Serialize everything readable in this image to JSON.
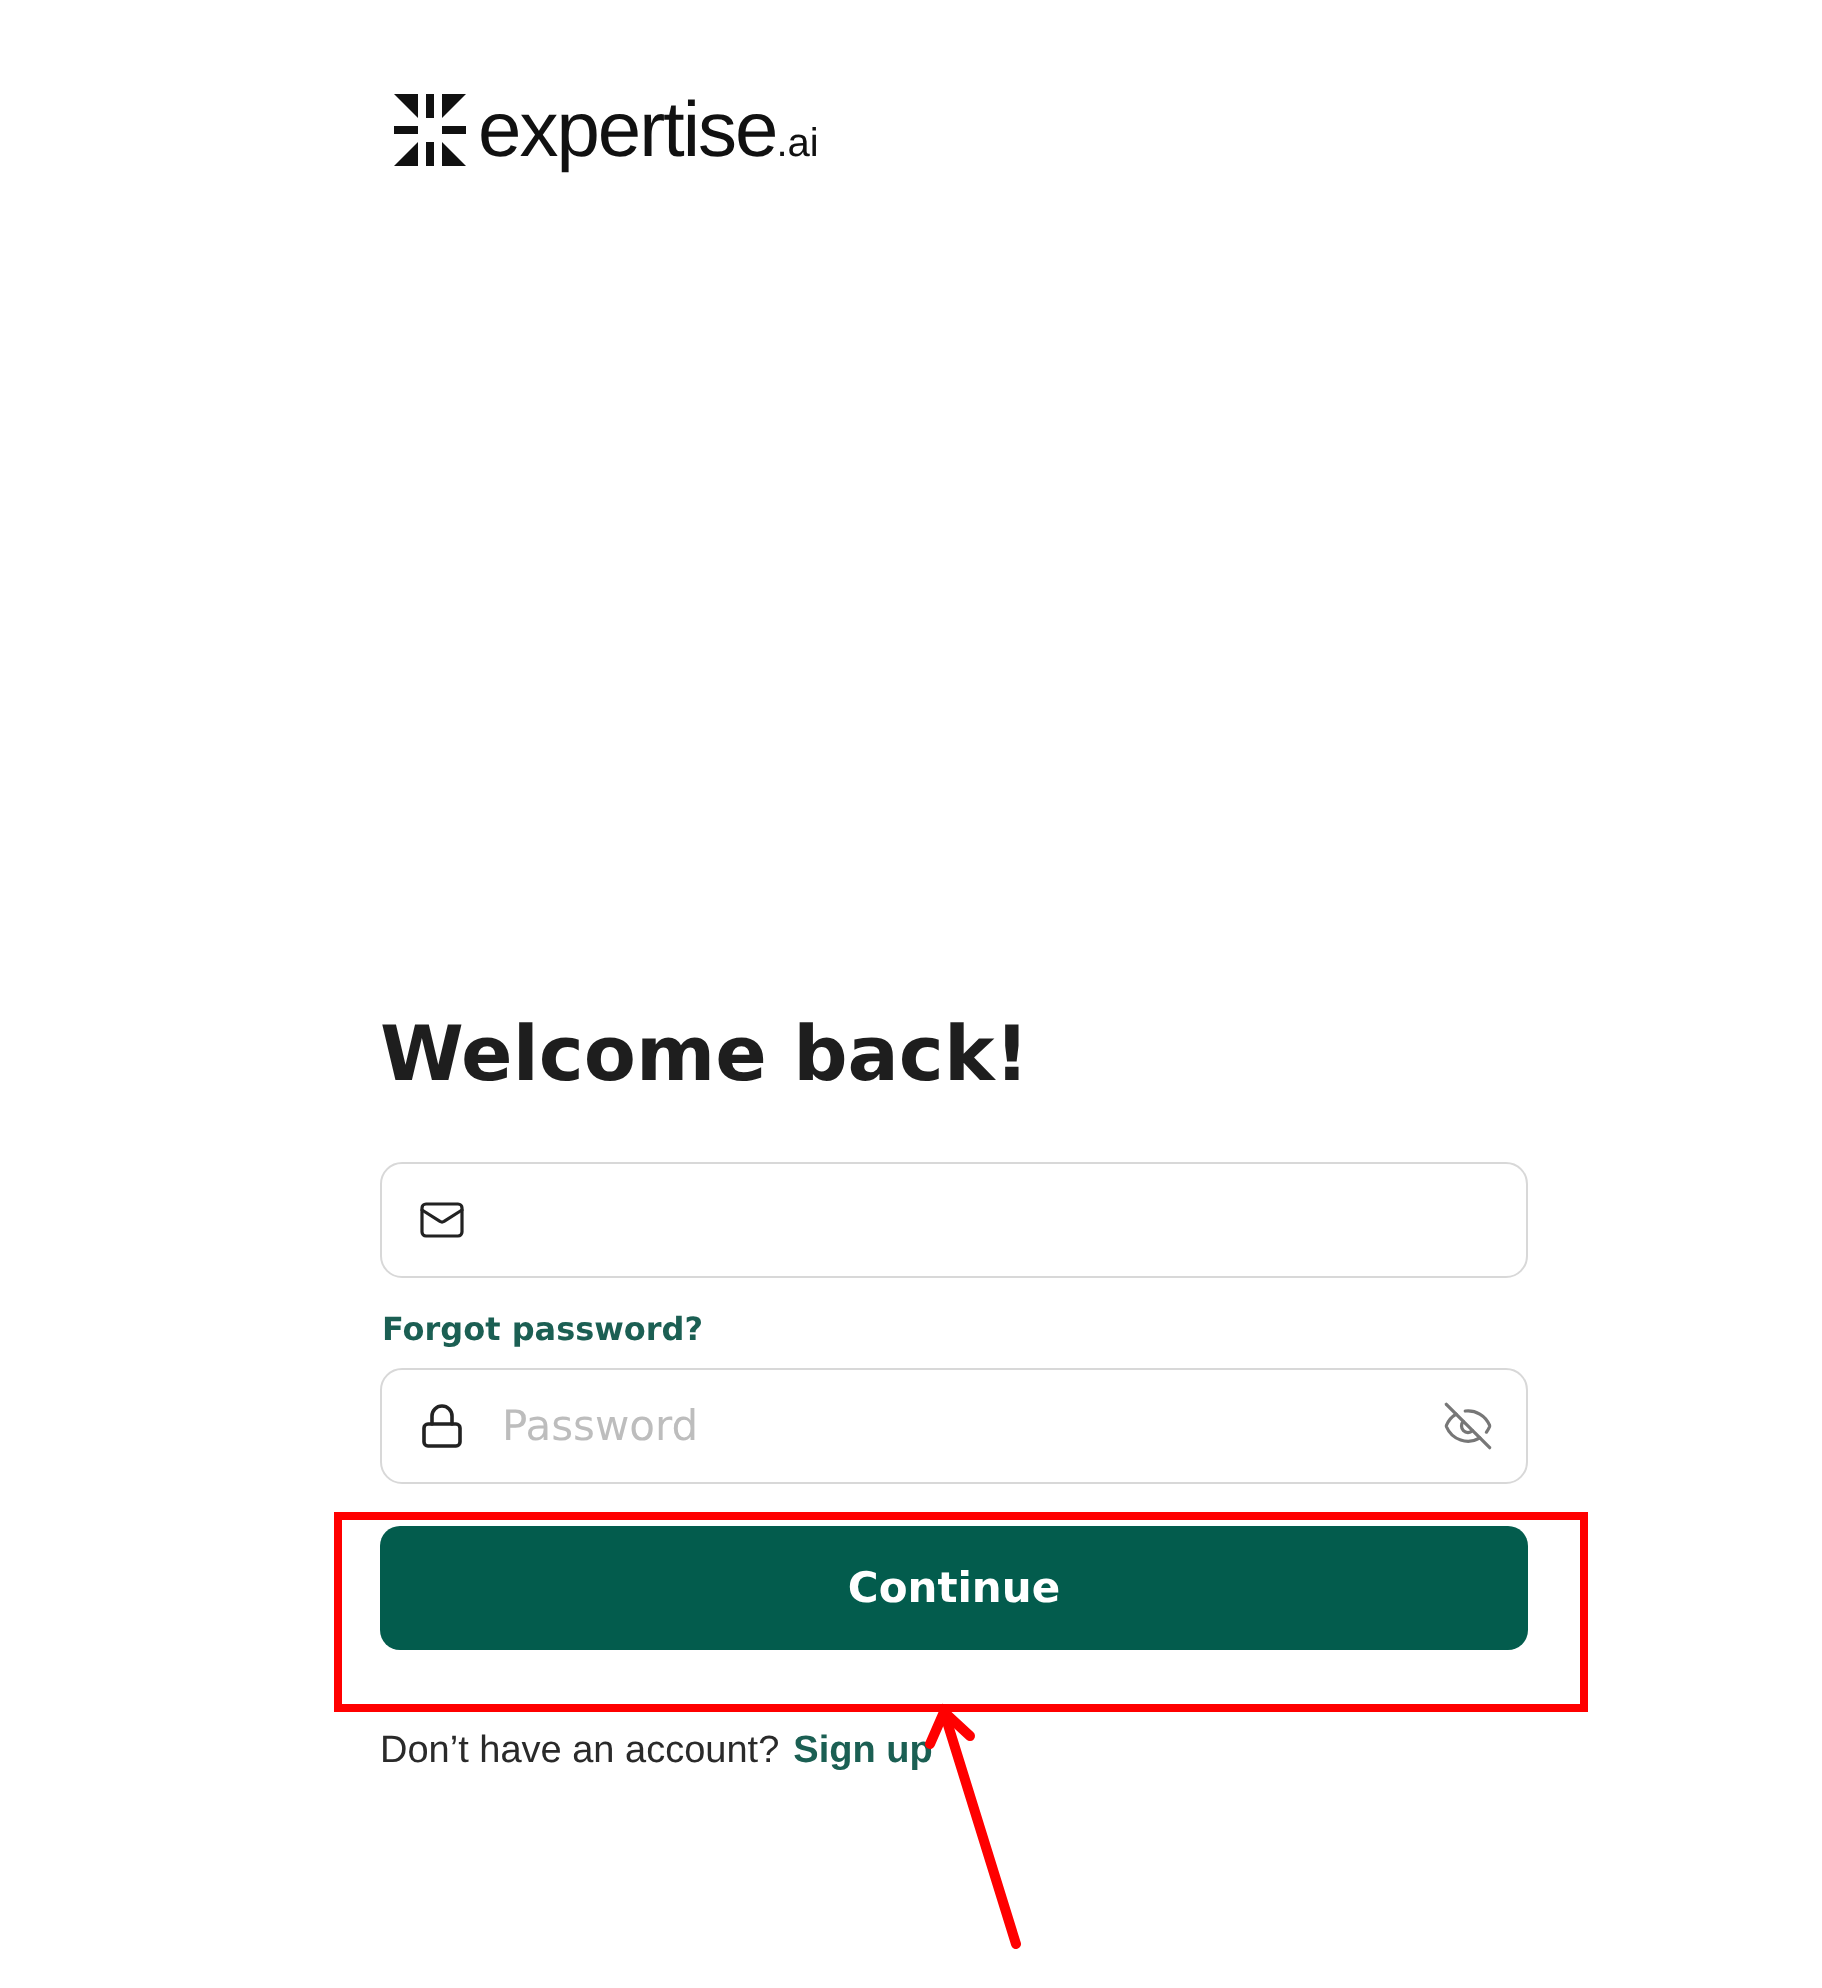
{
  "logo": {
    "name": "expertise",
    "suffix": ".ai"
  },
  "heading": "Welcome back!",
  "forgot_password_link": "Forgot password?",
  "password_field": {
    "placeholder": "Password",
    "visible": false
  },
  "continue_button": "Continue",
  "signup_prompt": {
    "text": "Don’t have an account?",
    "link": "Sign up"
  },
  "annotation": {
    "highlight_box": true,
    "arrow": true
  }
}
